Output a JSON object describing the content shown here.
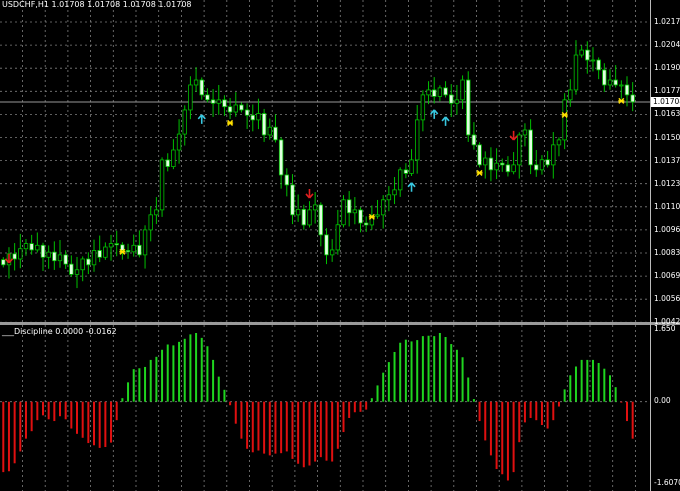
{
  "header": {
    "symbol_tf": "USDCHF,H1",
    "ohlc": [
      "1.01708",
      "1.01708",
      "1.01708",
      "1.01708"
    ]
  },
  "indicator": {
    "label": "___Discipline 0.0000 -0.0162",
    "max_label": "1.650",
    "zero_label": "0.00",
    "min_label": "-1.6070"
  },
  "price_axis": {
    "labels": [
      "1.02175",
      "1.02040",
      "1.01905",
      "1.01770",
      "1.01635",
      "1.01500",
      "1.01370",
      "1.01235",
      "1.01100",
      "1.00965",
      "1.00830",
      "1.00695",
      "1.00560",
      "1.00425"
    ],
    "current": "1.01708"
  },
  "colors": {
    "bg": "#000000",
    "grid": "#7f7f7f",
    "bull": "#00c000",
    "bear_fill": "#e0ffe0",
    "hist_up": "#1fd51f",
    "hist_down": "#e01010",
    "arrow_up": "#38c8e0",
    "arrow_down": "#e02020",
    "star": "#ffe000"
  },
  "chart_data": {
    "type": "candlestick",
    "price_range": [
      1.00425,
      1.0231
    ],
    "close": [
      1.00756,
      1.0082,
      1.0079,
      1.0085,
      1.0088,
      1.00843,
      1.0087,
      1.008,
      1.0083,
      1.0078,
      1.00814,
      1.0076,
      1.007,
      1.00727,
      1.0079,
      1.00756,
      1.0084,
      1.008,
      1.0086,
      1.0088,
      1.00873,
      1.0084,
      1.00832,
      1.0087,
      1.00814,
      1.0096,
      1.01048,
      1.01077,
      1.01369,
      1.0133,
      1.01427,
      1.0152,
      1.01661,
      1.01807,
      1.01836,
      1.01749,
      1.0172,
      1.017,
      1.0172,
      1.0168,
      1.01649,
      1.0169,
      1.01661,
      1.0163,
      1.01603,
      1.0164,
      1.01515,
      1.0156,
      1.01486,
      1.01281,
      1.01223,
      1.01048,
      1.0108,
      1.00989,
      1.01077,
      1.01106,
      1.00931,
      1.00814,
      1.00843,
      1.0099,
      1.01136,
      1.0106,
      1.01077,
      1.01,
      1.00989,
      1.0104,
      1.01048,
      1.01136,
      1.01165,
      1.01194,
      1.01311,
      1.0129,
      1.01369,
      1.01603,
      1.01749,
      1.01778,
      1.0174,
      1.0179,
      1.01749,
      1.017,
      1.0172,
      1.01836,
      1.01515,
      1.01457,
      1.0134,
      1.0138,
      1.01311,
      1.0135,
      1.0134,
      1.013,
      1.0134,
      1.01515,
      1.01544,
      1.0134,
      1.01311,
      1.0137,
      1.0134,
      1.01457,
      1.01486,
      1.0172,
      1.01778,
      1.01982,
      1.02011,
      1.01953,
      1.01953,
      1.01895,
      1.01807,
      1.01836,
      1.01807,
      1.01807,
      1.01749,
      1.01708
    ],
    "signals": [
      {
        "bar": 35,
        "type": "up",
        "price": 1.01603
      },
      {
        "bar": 72,
        "type": "up",
        "price": 1.01206
      },
      {
        "bar": 76,
        "type": "up",
        "price": 1.01632
      },
      {
        "bar": 78,
        "type": "up",
        "price": 1.01591
      },
      {
        "bar": 1,
        "type": "down",
        "price": 1.00797
      },
      {
        "bar": 54,
        "type": "down",
        "price": 1.01176
      },
      {
        "bar": 90,
        "type": "down",
        "price": 1.01515
      },
      {
        "bar": 21,
        "type": "star",
        "price": 1.00832
      },
      {
        "bar": 40,
        "type": "star",
        "price": 1.01585
      },
      {
        "bar": 65,
        "type": "star",
        "price": 1.01036
      },
      {
        "bar": 84,
        "type": "star",
        "price": 1.01293
      },
      {
        "bar": 99,
        "type": "star",
        "price": 1.01632
      },
      {
        "bar": 109,
        "type": "star",
        "price": 1.01714
      }
    ],
    "histogram": [
      -1.6,
      -1.58,
      -1.4,
      -1.13,
      -0.84,
      -0.67,
      -0.42,
      -0.31,
      -0.4,
      -0.44,
      -0.33,
      -0.4,
      -0.61,
      -0.73,
      -0.82,
      -0.94,
      -0.99,
      -1.05,
      -1.03,
      -0.93,
      -0.42,
      0.08,
      0.44,
      0.74,
      0.76,
      0.79,
      0.95,
      1.02,
      1.18,
      1.3,
      1.28,
      1.36,
      1.43,
      1.53,
      1.56,
      1.45,
      1.26,
      0.95,
      0.57,
      0.27,
      -0.08,
      -0.5,
      -0.84,
      -1.07,
      -1.15,
      -1.11,
      -1.18,
      -1.22,
      -1.18,
      -1.17,
      -1.13,
      -1.3,
      -1.41,
      -1.49,
      -1.45,
      -1.36,
      -1.26,
      -1.34,
      -1.36,
      -1.07,
      -0.69,
      -0.37,
      -0.24,
      -0.23,
      -0.18,
      0.08,
      0.37,
      0.66,
      0.9,
      1.13,
      1.34,
      1.41,
      1.37,
      1.4,
      1.49,
      1.5,
      1.49,
      1.56,
      1.47,
      1.31,
      1.18,
      1.01,
      0.55,
      0.06,
      -0.44,
      -0.88,
      -1.22,
      -1.53,
      -1.65,
      -1.79,
      -1.6,
      -0.92,
      -0.47,
      -0.37,
      -0.42,
      -0.53,
      -0.61,
      -0.42,
      -0.11,
      0.28,
      0.6,
      0.8,
      0.95,
      0.95,
      0.95,
      0.88,
      0.75,
      0.6,
      0.33,
      -0.02,
      -0.44,
      -0.84
    ],
    "histogram_range": [
      -1.607,
      1.65
    ]
  }
}
